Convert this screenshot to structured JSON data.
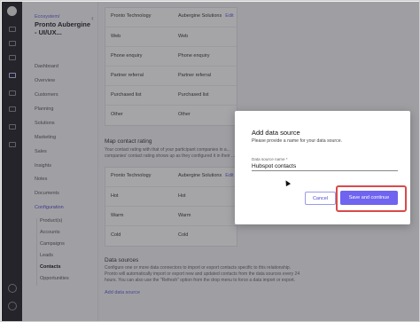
{
  "nav": {
    "breadcrumb": "Ecosystem/",
    "project_title": "Pronto Aubergine - UI/UX...",
    "collapse_glyph": "‹",
    "items": [
      {
        "label": "Dashboard"
      },
      {
        "label": "Overview"
      },
      {
        "label": "Customers"
      },
      {
        "label": "Planning"
      },
      {
        "label": "Solutions"
      },
      {
        "label": "Marketing"
      },
      {
        "label": "Sales"
      },
      {
        "label": "Insights"
      },
      {
        "label": "Notes"
      },
      {
        "label": "Documents"
      },
      {
        "label": "Configuration"
      },
      {
        "label": "Product(s)"
      },
      {
        "label": "Accounts"
      },
      {
        "label": "Campaigns"
      },
      {
        "label": "Leads"
      },
      {
        "label": "Contacts"
      },
      {
        "label": "Opportunities"
      }
    ]
  },
  "source_table": {
    "col1": "Pronto Technology",
    "col2": "Aubergine Solutions",
    "edit": "Edit",
    "rows": [
      {
        "a": "Web",
        "b": "Web"
      },
      {
        "a": "Phone enquiry",
        "b": "Phone enquiry"
      },
      {
        "a": "Partner referral",
        "b": "Partner referral"
      },
      {
        "a": "Purchased list",
        "b": "Purchased list"
      },
      {
        "a": "Other",
        "b": "Other"
      }
    ]
  },
  "rating": {
    "title": "Map contact rating",
    "desc": "Your contact rating with that of your participant companies in a... companies' contact rating shows up as they configured it in their ...",
    "col1": "Pronto Technology",
    "col2": "Aubergine Solutions",
    "edit": "Edit",
    "rows": [
      {
        "a": "Hot",
        "b": "Hot"
      },
      {
        "a": "Warm",
        "b": "Warm"
      },
      {
        "a": "Cold",
        "b": "Cold"
      }
    ]
  },
  "data_sources": {
    "title": "Data sources",
    "desc1": "Configure one or more data connectors to import or export contacts specific to this relationship.",
    "desc2": "Pronto will automatically import or export new and updated contacts from the data sources every 24",
    "desc3": "hours. You can also use the \"Refresh\" option from the drop menu to force a data import or export.",
    "add_label": "Add data source"
  },
  "modal": {
    "title": "Add data source",
    "subtitle": "Please provide a name for your data source.",
    "field_label": "Data source name *",
    "field_value": "Hubspot contacts",
    "cancel_label": "Cancel",
    "save_label": "Save and continue"
  }
}
